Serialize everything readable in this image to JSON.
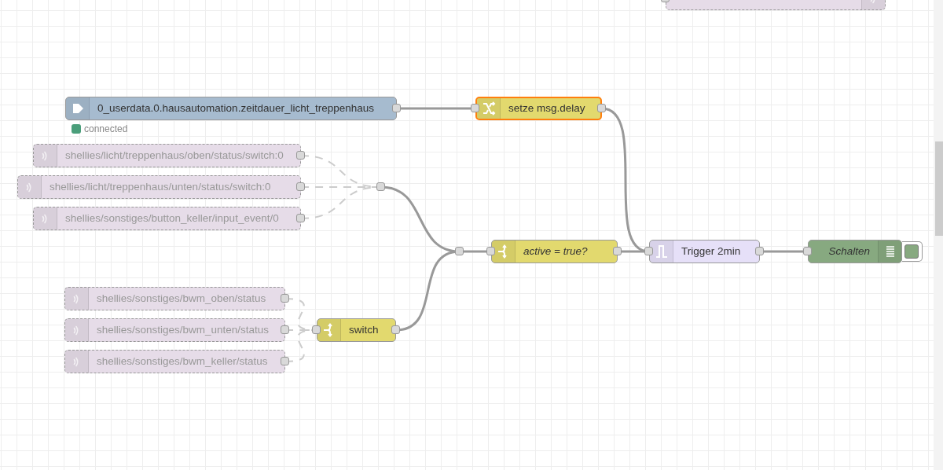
{
  "nodes": [
    {
      "kind": "iobroker-in",
      "label": "0_userdata.0.hausautomation.zeitdauer_licht_treppenhaus",
      "italic": false,
      "disabled": false,
      "selected": false,
      "status": {
        "text": "connected",
        "color": "#4a9e7a"
      }
    },
    {
      "kind": "mqtt-in",
      "label": "shellies/licht/treppenhaus/oben/status/switch:0",
      "italic": false,
      "disabled": true,
      "selected": false
    },
    {
      "kind": "mqtt-in",
      "label": "shellies/licht/treppenhaus/unten/status/switch:0",
      "italic": false,
      "disabled": true,
      "selected": false
    },
    {
      "kind": "mqtt-in",
      "label": "shellies/sonstiges/button_keller/input_event/0",
      "italic": false,
      "disabled": true,
      "selected": false
    },
    {
      "kind": "junction",
      "disabled": false,
      "selected": false
    },
    {
      "kind": "change",
      "label": "setze msg.delay",
      "italic": false,
      "disabled": false,
      "selected": true
    },
    {
      "kind": "junction",
      "disabled": false,
      "selected": false
    },
    {
      "kind": "switch",
      "label": "active = true?",
      "italic": true,
      "disabled": false,
      "selected": false
    },
    {
      "kind": "trigger",
      "label": "Trigger 2min",
      "italic": false,
      "disabled": false,
      "selected": false
    },
    {
      "kind": "debug",
      "label": "Schalten",
      "italic": true,
      "disabled": false,
      "selected": false,
      "active": true
    },
    {
      "kind": "mqtt-in",
      "label": "shellies/sonstiges/bwm_oben/status",
      "italic": false,
      "disabled": true,
      "selected": false
    },
    {
      "kind": "mqtt-in",
      "label": "shellies/sonstiges/bwm_unten/status",
      "italic": false,
      "disabled": true,
      "selected": false
    },
    {
      "kind": "mqtt-in",
      "label": "shellies/sonstiges/bwm_keller/status",
      "italic": false,
      "disabled": true,
      "selected": false
    },
    {
      "kind": "switch",
      "label": "switch",
      "italic": false,
      "disabled": false,
      "selected": false
    },
    {
      "kind": "mqtt-out",
      "disabled": true,
      "selected": false
    }
  ]
}
